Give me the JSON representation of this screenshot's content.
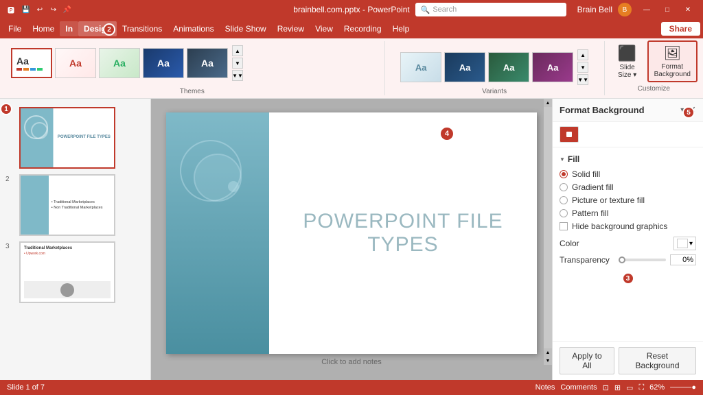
{
  "titlebar": {
    "filename": "brainbell.com.pptx - PowerPoint",
    "user": "Brain Bell",
    "minimize": "—",
    "maximize": "□",
    "close": "✕"
  },
  "searchbar": {
    "placeholder": "Search"
  },
  "menubar": {
    "items": [
      "File",
      "Home",
      "Insert",
      "Design",
      "Transitions",
      "Animations",
      "Slide Show",
      "Review",
      "View",
      "Recording",
      "Help"
    ],
    "active": "Design",
    "share_label": "Share"
  },
  "ribbon": {
    "themes_label": "Themes",
    "variants_label": "Variants",
    "customize_label": "Customize",
    "themes": [
      {
        "label": "Aa",
        "class": "th1"
      },
      {
        "label": "Aa",
        "class": "th2"
      },
      {
        "label": "Aa",
        "class": "th3"
      },
      {
        "label": "Aa",
        "class": "th4"
      },
      {
        "label": "Aa",
        "class": "th5"
      }
    ],
    "slide_size_label": "Slide\nSize",
    "format_background_label": "Format\nBackground"
  },
  "slides": [
    {
      "number": "1",
      "title": "POWERPOINT FILE TYPES",
      "selected": true
    },
    {
      "number": "2",
      "bullets": [
        "Traditional Marketplaces",
        "Non Traditional Marketplaces"
      ],
      "selected": false
    },
    {
      "number": "3",
      "title": "Traditional Marketplaces",
      "subtitle": "Upwork.com",
      "selected": false
    }
  ],
  "canvas": {
    "slide_title": "POWERPOINT FILE\nTYPES",
    "add_notes": "Click to add notes"
  },
  "format_background": {
    "title": "Format Background",
    "fill_label": "Fill",
    "options": [
      {
        "id": "solid",
        "label": "Solid fill",
        "selected": true
      },
      {
        "id": "gradient",
        "label": "Gradient fill",
        "selected": false
      },
      {
        "id": "picture",
        "label": "Picture or texture fill",
        "selected": false
      },
      {
        "id": "pattern",
        "label": "Pattern fill",
        "selected": false
      }
    ],
    "hide_label": "Hide background graphics",
    "color_label": "Color",
    "transparency_label": "Transparency",
    "transparency_value": "0%",
    "apply_all_label": "Apply to All",
    "reset_label": "Reset Background"
  },
  "statusbar": {
    "slide_info": "Slide 1 of 7",
    "notes_label": "Notes",
    "comments_label": "Comments",
    "zoom": "62%"
  },
  "steps": [
    {
      "number": "1"
    },
    {
      "number": "2"
    },
    {
      "number": "3"
    },
    {
      "number": "4"
    },
    {
      "number": "5"
    }
  ]
}
